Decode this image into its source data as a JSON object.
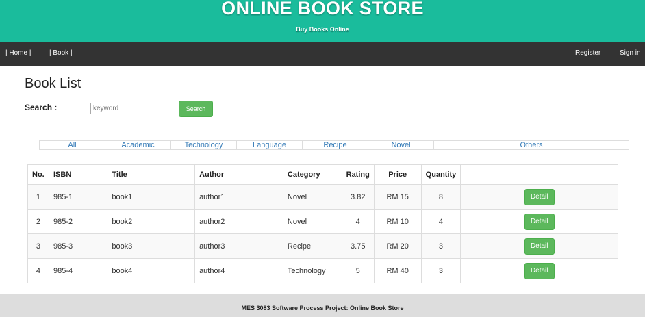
{
  "header": {
    "title": "ONLINE BOOK STORE",
    "subtitle": "Buy Books Online"
  },
  "nav": {
    "home": "| Home |",
    "book": "| Book |",
    "register": "Register",
    "signin": "Sign in"
  },
  "page": {
    "title": "Book List",
    "search_label": "Search :",
    "search_placeholder": "keyword",
    "search_value": "",
    "search_button": "Search"
  },
  "categories": [
    "All",
    "Academic",
    "Technology",
    "Language",
    "Recipe",
    "Novel",
    "Others"
  ],
  "table": {
    "headers": [
      "No.",
      "ISBN",
      "Title",
      "Author",
      "Category",
      "Rating",
      "Price",
      "Quantity",
      ""
    ],
    "detail_label": "Detail",
    "rows": [
      [
        "1",
        "985-1",
        "book1",
        "author1",
        "Novel",
        "3.82",
        "RM 15",
        "8"
      ],
      [
        "2",
        "985-2",
        "book2",
        "author2",
        "Novel",
        "4",
        "RM 10",
        "4"
      ],
      [
        "3",
        "985-3",
        "book3",
        "author3",
        "Recipe",
        "3.75",
        "RM 20",
        "3"
      ],
      [
        "4",
        "985-4",
        "book4",
        "author4",
        "Technology",
        "5",
        "RM 40",
        "3"
      ]
    ]
  },
  "footer": {
    "text": "MES 3083 Software Process Project: Online Book Store"
  },
  "colors": {
    "banner": "#1abc9c",
    "navbar": "#333333",
    "button": "#5cb85c",
    "link": "#337ab7",
    "footer": "#dddddd"
  }
}
